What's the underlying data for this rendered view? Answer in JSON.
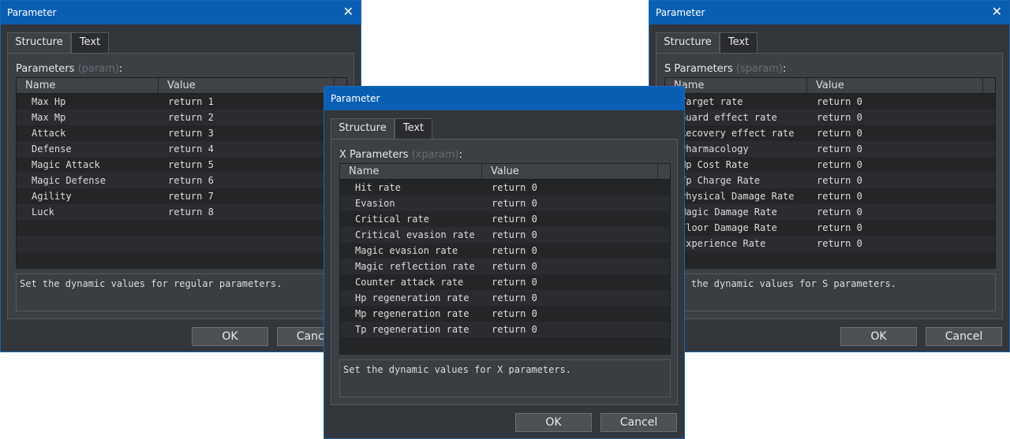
{
  "dialogs": {
    "left": {
      "title": "Parameter",
      "tabs": [
        "Structure",
        "Text"
      ],
      "section_label": "Parameters",
      "section_code": "(param)",
      "section_colon": ":",
      "columns": [
        "Name",
        "Value"
      ],
      "rows": [
        {
          "name": "Max Hp",
          "value": "return 1"
        },
        {
          "name": "Max Mp",
          "value": "return 2"
        },
        {
          "name": "Attack",
          "value": "return 3"
        },
        {
          "name": "Defense",
          "value": "return 4"
        },
        {
          "name": "Magic Attack",
          "value": "return 5"
        },
        {
          "name": "Magic Defense",
          "value": "return 6"
        },
        {
          "name": "Agility",
          "value": "return 7"
        },
        {
          "name": "Luck",
          "value": "return 8"
        }
      ],
      "description": "Set the dynamic values for regular parameters.",
      "ok_label": "OK",
      "cancel_label": "Cancel"
    },
    "middle": {
      "title": "Parameter",
      "tabs": [
        "Structure",
        "Text"
      ],
      "section_label": "X Parameters",
      "section_code": "(xparam)",
      "section_colon": ":",
      "columns": [
        "Name",
        "Value"
      ],
      "rows": [
        {
          "name": "Hit rate",
          "value": "return 0"
        },
        {
          "name": "Evasion",
          "value": "return 0"
        },
        {
          "name": "Critical rate",
          "value": "return 0"
        },
        {
          "name": "Critical evasion rate",
          "value": "return 0"
        },
        {
          "name": "Magic evasion rate",
          "value": "return 0"
        },
        {
          "name": "Magic reflection rate",
          "value": "return 0"
        },
        {
          "name": "Counter attack rate",
          "value": "return 0"
        },
        {
          "name": "Hp regeneration rate",
          "value": "return 0"
        },
        {
          "name": "Mp regeneration rate",
          "value": "return 0"
        },
        {
          "name": "Tp regeneration rate",
          "value": "return 0"
        }
      ],
      "description": "Set the dynamic values for X parameters.",
      "ok_label": "OK",
      "cancel_label": "Cancel"
    },
    "right": {
      "title": "Parameter",
      "tabs": [
        "Structure",
        "Text"
      ],
      "section_label": "S Parameters",
      "section_code": "(sparam)",
      "section_colon": ":",
      "columns": [
        "Name",
        "Value"
      ],
      "rows": [
        {
          "name": "Target rate",
          "value": "return 0"
        },
        {
          "name": "Guard effect rate",
          "value": "return 0"
        },
        {
          "name": "Recovery effect rate",
          "value": "return 0"
        },
        {
          "name": "Pharmacology",
          "value": "return 0"
        },
        {
          "name": "Mp Cost Rate",
          "value": "return 0"
        },
        {
          "name": "Tp Charge Rate",
          "value": "return 0"
        },
        {
          "name": "Physical Damage Rate",
          "value": "return 0"
        },
        {
          "name": "Magic Damage Rate",
          "value": "return 0"
        },
        {
          "name": "Floor Damage Rate",
          "value": "return 0"
        },
        {
          "name": "Experience Rate",
          "value": "return 0"
        }
      ],
      "description": "Set the dynamic values for S parameters.",
      "ok_label": "OK",
      "cancel_label": "Cancel"
    }
  }
}
